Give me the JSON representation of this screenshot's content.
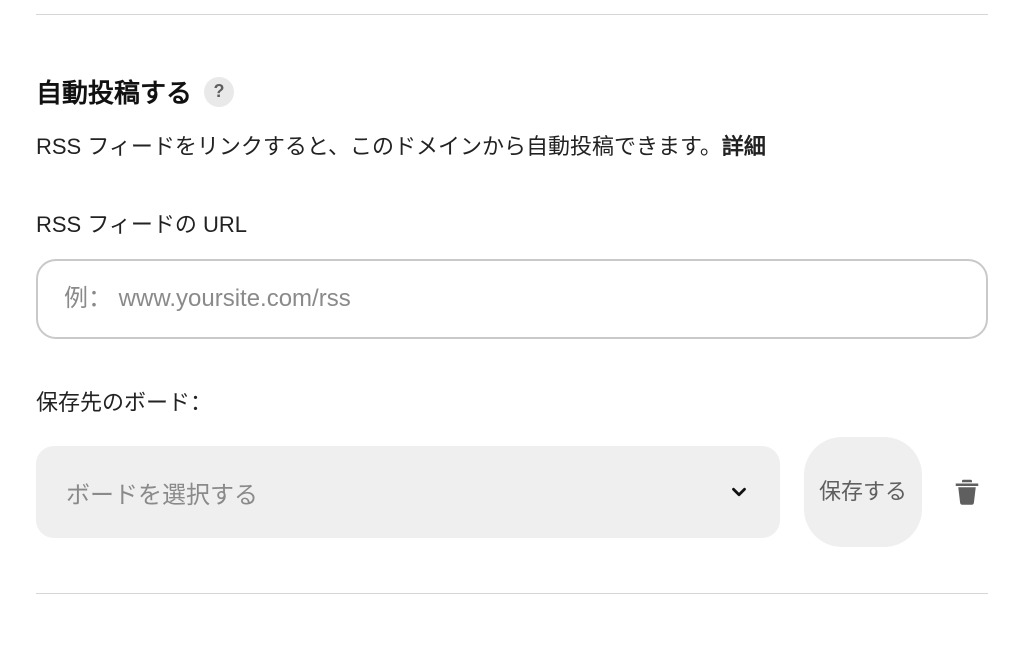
{
  "section": {
    "heading": "自動投稿する",
    "help_symbol": "?",
    "description_prefix": "RSS フィードをリンクすると、このドメインから自動投稿できます。",
    "description_link": "詳細"
  },
  "rss": {
    "label": "RSS フィードの URL",
    "placeholder": "例： www.yoursite.com/rss",
    "value": ""
  },
  "board": {
    "label": "保存先のボード：",
    "placeholder": "ボードを選択する"
  },
  "actions": {
    "save_label": "保存する"
  }
}
